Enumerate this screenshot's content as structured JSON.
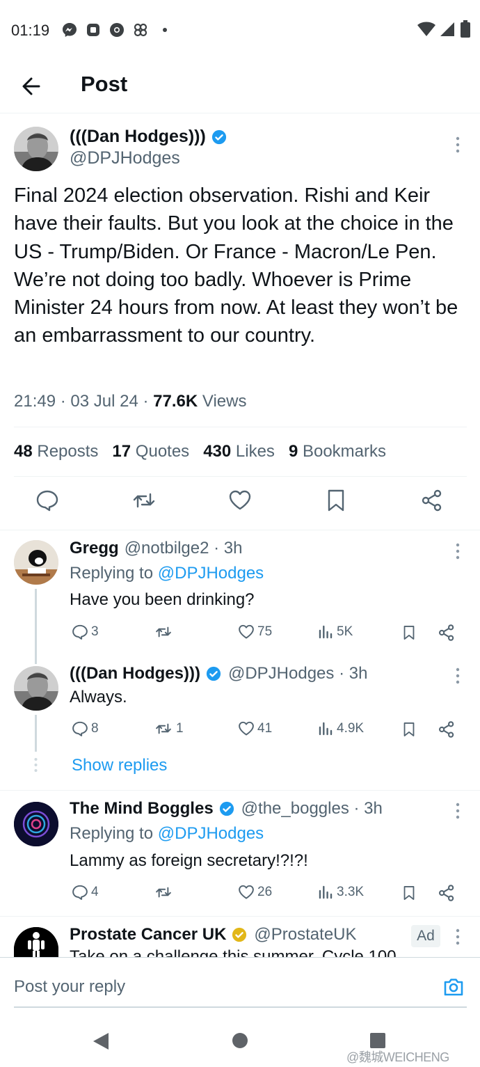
{
  "status_bar": {
    "time": "01:19",
    "left_icons": [
      "messenger-icon",
      "app-icon",
      "chrome-icon",
      "pinwheel-icon",
      "dot-icon"
    ],
    "right_icons": [
      "wifi-icon",
      "signal-icon",
      "battery-icon"
    ]
  },
  "header": {
    "title": "Post",
    "back_icon": "arrow-left-icon"
  },
  "post": {
    "author_name": "(((Dan Hodges)))",
    "author_handle": "@DPJHodges",
    "verified": true,
    "text": "Final 2024 election observation. Rishi and Keir have their faults. But you look at the choice in the US - Trump/Biden. Or France - Macron/Le Pen. We’re not doing too badly. Whoever is Prime Minister 24 hours from now. At least they won’t be an embarrassment to our country.",
    "time": "21:49",
    "date": "03 Jul 24",
    "sep": "·",
    "views_count": "77.6K",
    "views_label": "Views",
    "stats": [
      {
        "count": "48",
        "label": "Reposts"
      },
      {
        "count": "17",
        "label": "Quotes"
      },
      {
        "count": "430",
        "label": "Likes"
      },
      {
        "count": "9",
        "label": "Bookmarks"
      }
    ],
    "actions": [
      "reply-icon",
      "repost-icon",
      "like-icon",
      "bookmark-icon",
      "share-icon"
    ]
  },
  "replies": [
    {
      "name": "Gregg",
      "handle": "@notbilge2 · 3h",
      "replying_prefix": "Replying to",
      "replying_handle": "@DPJHodges",
      "text": "Have you been drinking?",
      "replies": "3",
      "reposts": "",
      "likes": "75",
      "views": "5K"
    },
    {
      "name": "(((Dan Hodges)))",
      "handle": "@DPJHodges · 3h",
      "verified": true,
      "text": "Always.",
      "replies": "8",
      "reposts": "1",
      "likes": "41",
      "views": "4.9K"
    },
    {
      "name": "The Mind Boggles",
      "handle": "@the_boggles · 3h",
      "verified": true,
      "replying_prefix": "Replying to",
      "replying_handle": "@DPJHodges",
      "text": "Lammy as foreign secretary!?!?!",
      "replies": "4",
      "reposts": "",
      "likes": "26",
      "views": "3.3K"
    }
  ],
  "show_replies": "Show replies",
  "ad": {
    "name": "Prostate Cancer UK",
    "handle": "@ProstateUK",
    "badge": "Ad",
    "text": "Take on a challenge this summer. Cycle 100"
  },
  "composer": {
    "placeholder": "Post your reply"
  },
  "watermark": "@魏城WEICHENG",
  "colors": {
    "blue": "#1d9bf0",
    "muted": "#536471",
    "gold": "#e2b719"
  }
}
